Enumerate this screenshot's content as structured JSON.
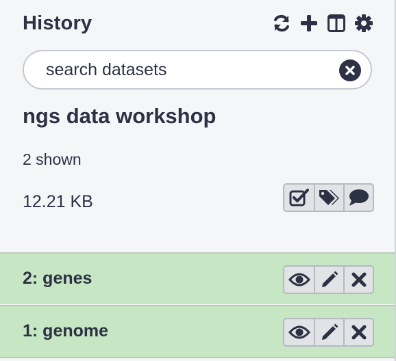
{
  "header": {
    "title": "History",
    "icons": [
      "refresh-icon",
      "plus-icon",
      "columns-icon",
      "gear-icon"
    ]
  },
  "search": {
    "placeholder": "search datasets",
    "value": ""
  },
  "history": {
    "name": "ngs data workshop",
    "shown": "2 shown",
    "size": "12.21 KB",
    "actions": [
      "select-items-icon",
      "tags-icon",
      "annotation-icon"
    ]
  },
  "datasets": [
    {
      "title": "2: genes",
      "state_color": "#c7e6c4",
      "actions": [
        "eye-icon",
        "pencil-icon",
        "delete-icon"
      ]
    },
    {
      "title": "1: genome",
      "state_color": "#c7e6c4",
      "actions": [
        "eye-icon",
        "pencil-icon",
        "delete-icon"
      ]
    }
  ],
  "colors": {
    "text": "#2c3143",
    "dataset_ok": "#c7e6c4",
    "panel_bg": "#f5f6f8"
  }
}
